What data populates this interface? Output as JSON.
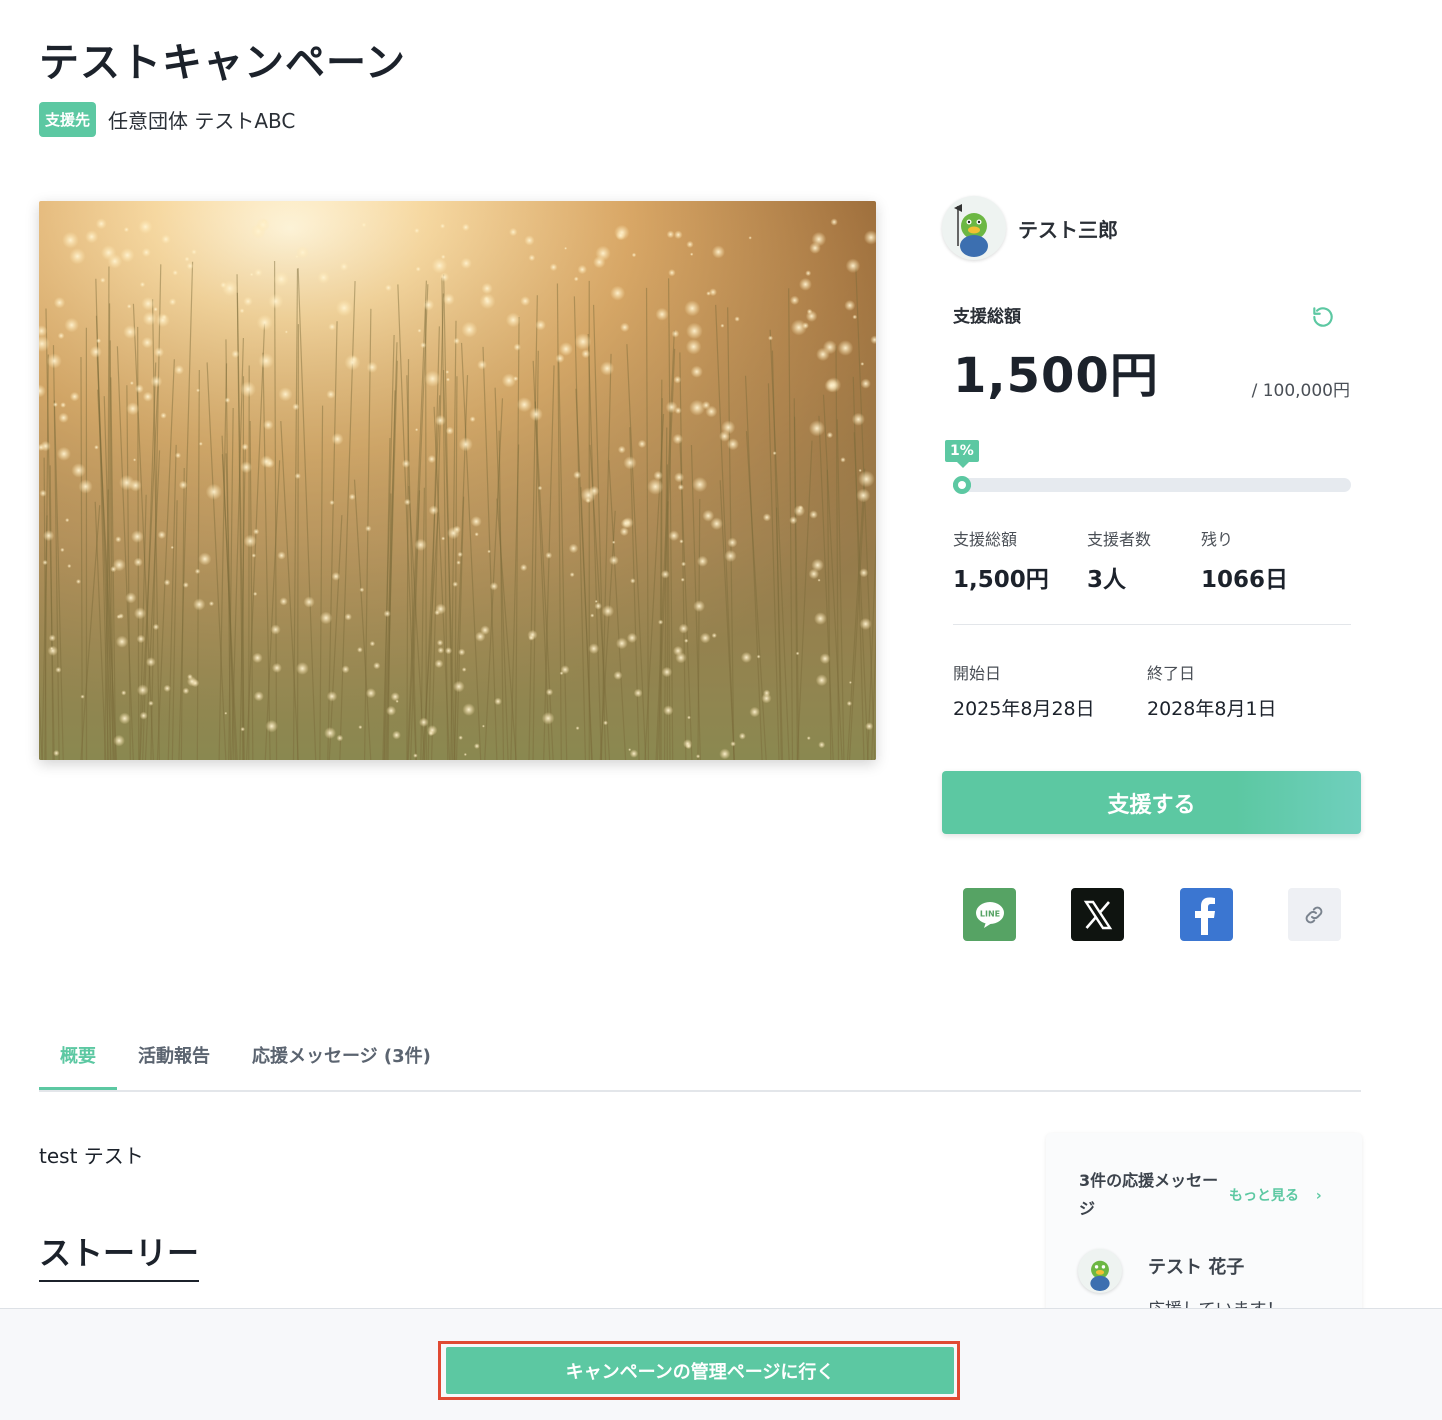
{
  "campaign": {
    "title": "テストキャンペーン",
    "org_badge": "支援先",
    "org_name": "任意団体 テストABC"
  },
  "owner": {
    "name": "テスト三郎"
  },
  "funding": {
    "total_label": "支援総額",
    "total_value": "1,500円",
    "goal": "/ 100,000円",
    "progress_label": "1%",
    "progress_fraction": 0.015,
    "stats": [
      {
        "label": "支援総額",
        "value": "1,500円"
      },
      {
        "label": "支援者数",
        "value": "3人"
      },
      {
        "label": "残り",
        "value": "1066日"
      }
    ],
    "dates": [
      {
        "label": "開始日",
        "value": "2025年8月28日"
      },
      {
        "label": "終了日",
        "value": "2028年8月1日"
      }
    ]
  },
  "support_button": "支援する",
  "share_icons": [
    "line-icon",
    "x-icon",
    "facebook-icon",
    "link-icon"
  ],
  "share_colors": {
    "line": "#56a364",
    "x": "#0f1410",
    "facebook": "#3b76d1",
    "link": "#eef0f4"
  },
  "tabs": [
    {
      "label": "概要",
      "active": true
    },
    {
      "label": "活動報告",
      "active": false
    },
    {
      "label": "応援メッセージ (3件)",
      "active": false
    }
  ],
  "summary_text": "test テスト",
  "story_heading": "ストーリー",
  "messages": {
    "title": "3件の応援メッセージ",
    "more_label": "もっと見る",
    "more_chevron": "›",
    "first": {
      "name": "テスト 花子",
      "text": "応援しています！"
    }
  },
  "footer": {
    "manage_button": "キャンペーンの管理ページに行く"
  },
  "colors": {
    "accent": "#5cc8a2",
    "highlight_frame": "#e04a33"
  }
}
